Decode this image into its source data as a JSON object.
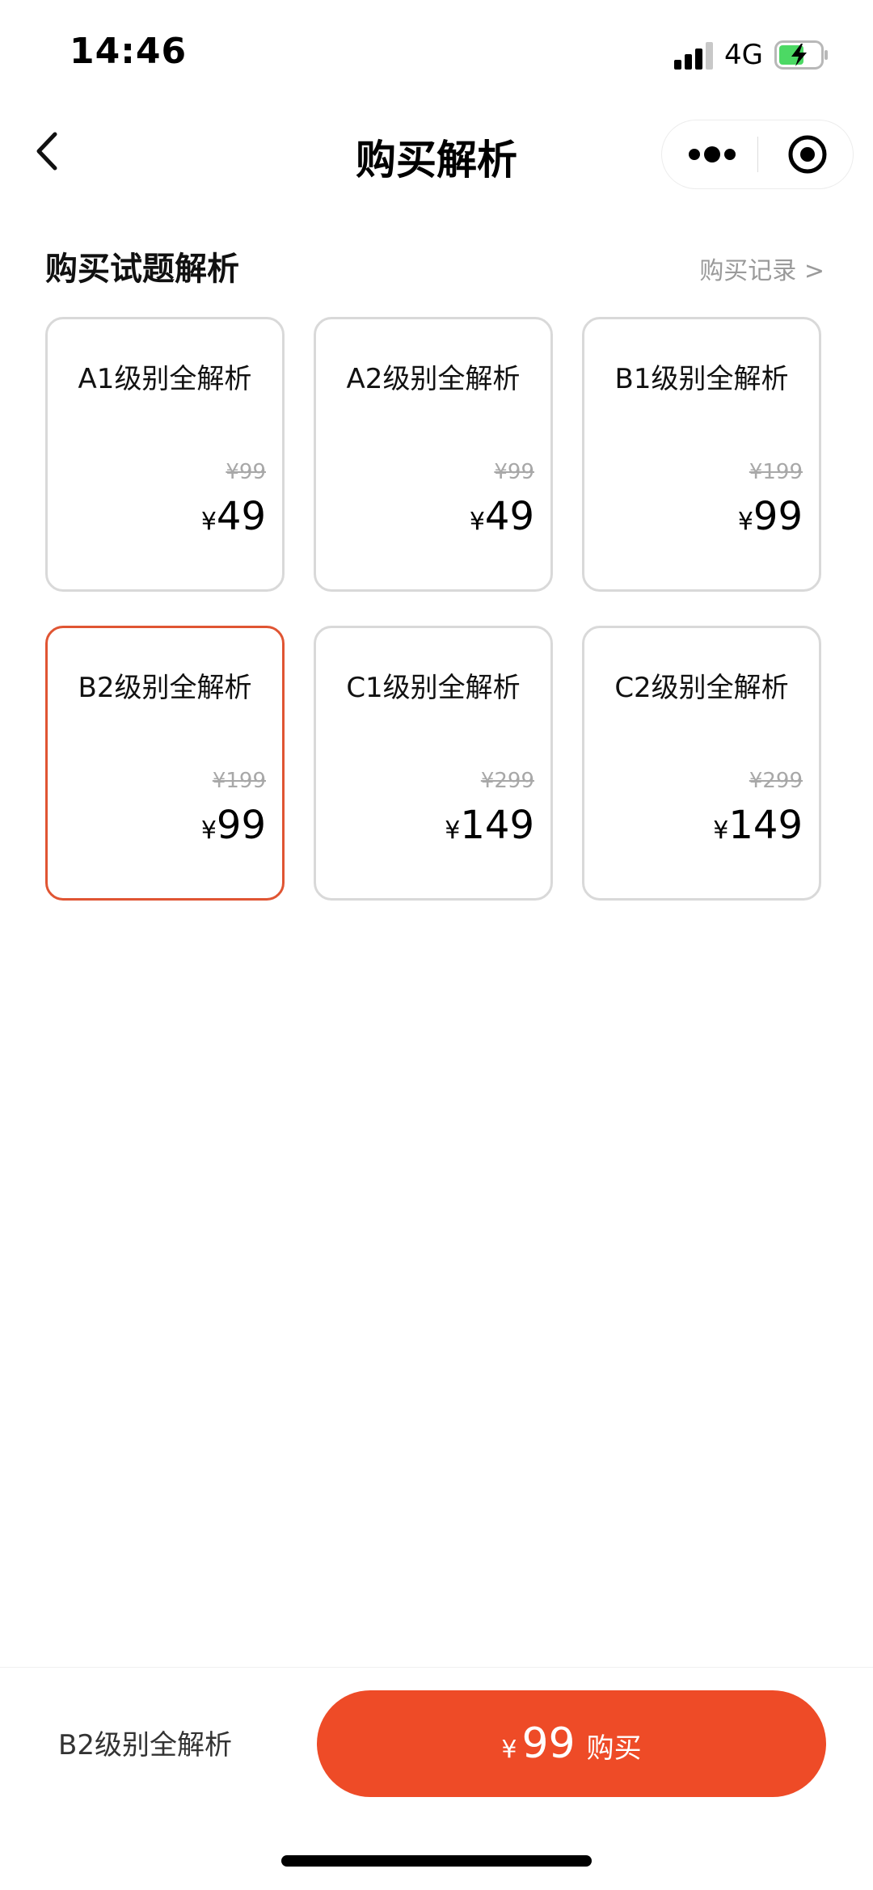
{
  "status_bar": {
    "time": "14:46",
    "network": "4G",
    "icons": [
      "signal-icon",
      "battery-charging-icon"
    ]
  },
  "nav": {
    "title": "购买解析",
    "icons": [
      "back-chevron-icon",
      "more-dots-icon",
      "close-target-icon"
    ]
  },
  "section": {
    "title": "购买试题解析",
    "records_link": "购买记录 >"
  },
  "products": [
    {
      "title": "A1级别全解析",
      "original": "¥99",
      "currency": "¥",
      "price": "49"
    },
    {
      "title": "A2级别全解析",
      "original": "¥99",
      "currency": "¥",
      "price": "49"
    },
    {
      "title": "B1级别全解析",
      "original": "¥199",
      "currency": "¥",
      "price": "99"
    },
    {
      "title": "B2级别全解析",
      "original": "¥199",
      "currency": "¥",
      "price": "99"
    },
    {
      "title": "C1级别全解析",
      "original": "¥299",
      "currency": "¥",
      "price": "149"
    },
    {
      "title": "C2级别全解析",
      "original": "¥299",
      "currency": "¥",
      "price": "149"
    }
  ],
  "selected_index": 3,
  "bottom": {
    "selected_label": "B2级别全解析",
    "currency": "¥",
    "price": "99",
    "buy_label": "购买"
  },
  "colors": {
    "accent": "#ee4b27",
    "selected_border": "#e05533",
    "card_border": "#d9d9d9",
    "muted_text": "#9a9a9a"
  }
}
